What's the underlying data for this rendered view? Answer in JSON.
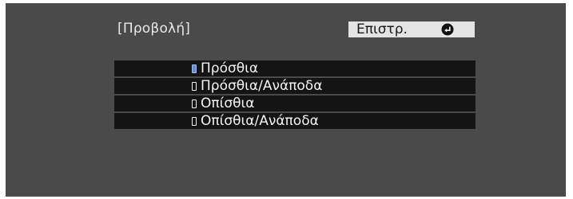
{
  "menu": {
    "title": "[Προβολή]",
    "back_label": "Επιστρ.",
    "back_icon": "enter-icon",
    "selected_index": 0,
    "options": [
      {
        "label": "Πρόσθια"
      },
      {
        "label": "Πρόσθια/Ανάποδα"
      },
      {
        "label": "Οπίσθια"
      },
      {
        "label": "Οπίσθια/Ανάποδα"
      }
    ]
  },
  "colors": {
    "screen_bg": "#4a4a4a",
    "row_bg": "#141414",
    "back_button_bg": "#e4e4e4",
    "selected_radio": "#5b8fe0"
  }
}
